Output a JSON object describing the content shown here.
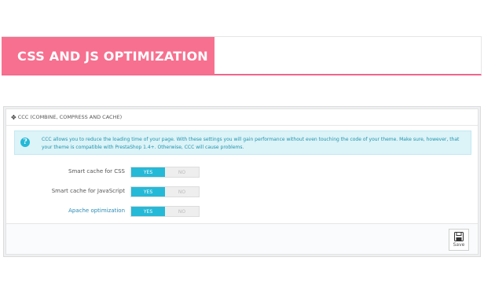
{
  "banner": {
    "title": "CSS AND JS OPTIMIZATION"
  },
  "panel": {
    "heading": "CCC (COMBINE, COMPRESS AND CACHE)",
    "heading_icon": "move-arrows-icon",
    "alert": {
      "icon": "info-icon",
      "text": "CCC allows you to reduce the loading time of your page. With these settings you will gain performance without even touching the code of your theme. Make sure, however, that your theme is compatible with PrestaShop 1.4+. Otherwise, CCC will cause problems."
    },
    "settings": [
      {
        "label": "Smart cache for CSS",
        "yes": "YES",
        "no": "NO",
        "value": "YES"
      },
      {
        "label": "Smart cache for JavaScript",
        "yes": "YES",
        "no": "NO",
        "value": "YES"
      },
      {
        "label": "Apache optimization",
        "yes": "YES",
        "no": "NO",
        "value": "YES"
      }
    ],
    "save_label": "Save",
    "colors": {
      "accent": "#25b9d7",
      "banner": "#f7708f"
    }
  }
}
